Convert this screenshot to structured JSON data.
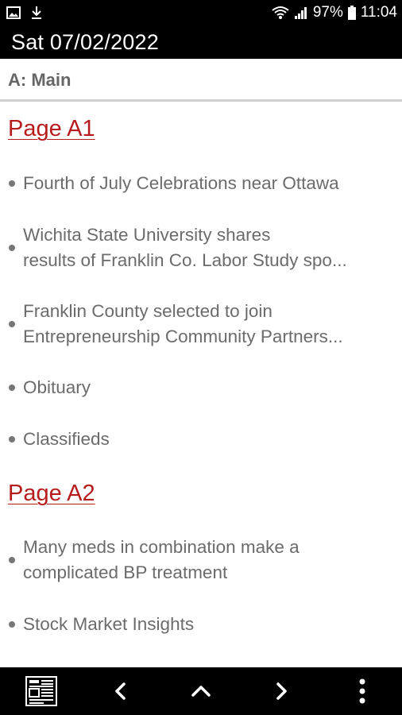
{
  "status_bar": {
    "battery": "97%",
    "time": "11:04",
    "icons": [
      "image-icon",
      "download-icon",
      "wifi-icon",
      "signal-icon",
      "battery-icon"
    ]
  },
  "title_bar": {
    "date": "Sat 07/02/2022"
  },
  "section": {
    "title": "A: Main"
  },
  "pages": [
    {
      "heading": "Page A1",
      "articles": [
        "Fourth of July Celebrations near Ottawa",
        [
          "Wichita State University shares",
          "results of Franklin Co. Labor  Study spo..."
        ],
        [
          "Franklin County selected to join",
          "Entrepreneurship  Community Partners..."
        ],
        "Obituary",
        "Classifieds"
      ]
    },
    {
      "heading": "Page A2",
      "articles": [
        [
          "Many meds in combination make a",
          "complicated BP treatment"
        ],
        "Stock Market Insights"
      ]
    }
  ],
  "bottom_nav": {
    "icons": [
      "page-grid-icon",
      "chevron-left-icon",
      "chevron-up-icon",
      "chevron-right-icon",
      "more-vert-icon"
    ]
  }
}
